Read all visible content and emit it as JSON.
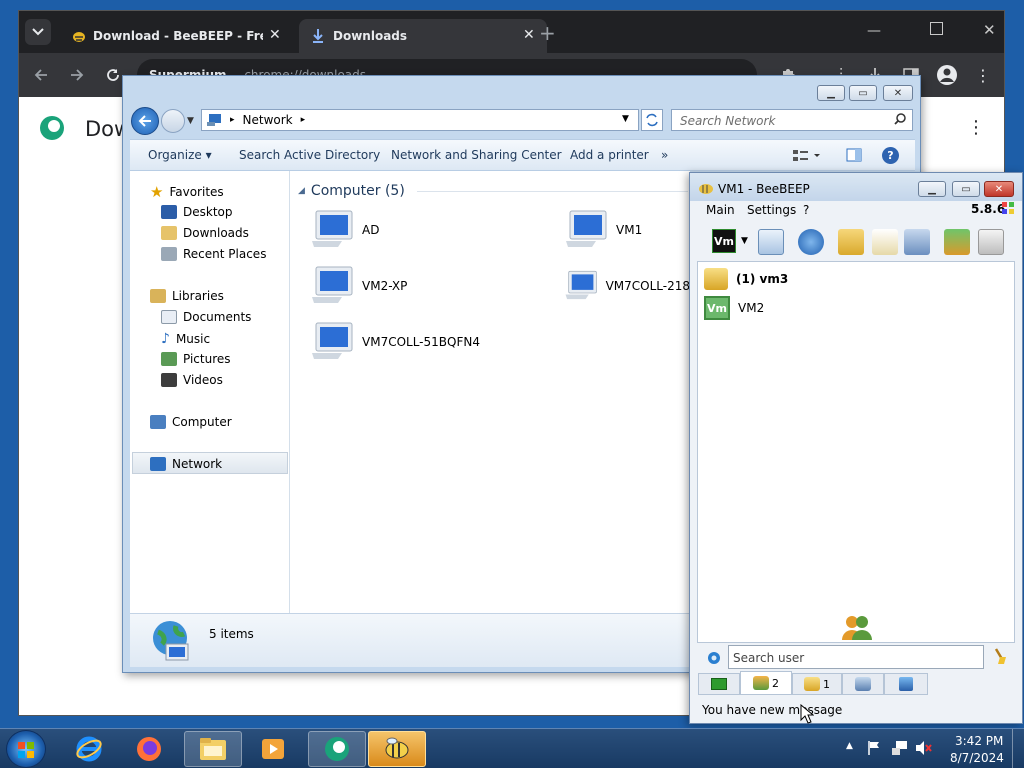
{
  "chrome": {
    "tabs": [
      {
        "label": "Download - BeeBEEP - Free Of",
        "active": false
      },
      {
        "label": "Downloads",
        "active": true
      }
    ],
    "address_scheme": "Supermium",
    "address_url": "chrome://downloads",
    "page_heading": "Dow"
  },
  "explorer": {
    "breadcrumb": "Network",
    "search_placeholder": "Search Network",
    "commands": [
      "Organize",
      "Search Active Directory",
      "Network and Sharing Center",
      "Add a printer",
      "»"
    ],
    "nav": {
      "favorites_label": "Favorites",
      "favorites": [
        "Desktop",
        "Downloads",
        "Recent Places"
      ],
      "libraries_label": "Libraries",
      "libraries": [
        "Documents",
        "Music",
        "Pictures",
        "Videos"
      ],
      "computer_label": "Computer",
      "network_label": "Network"
    },
    "group_header": "Computer (5)",
    "computers": [
      "AD",
      "VM1",
      "VM2-XP",
      "VM7COLL-218",
      "VM7COLL-51BQFN4"
    ],
    "status_count": "5 items"
  },
  "beebeep": {
    "title": "VM1 - BeeBEEP",
    "menu": [
      "Main",
      "Settings",
      "?"
    ],
    "version": "5.8.6",
    "avatar_label": "Vm",
    "users": [
      {
        "label": "(1) vm3",
        "bold": true
      },
      {
        "label": "VM2",
        "bold": false
      }
    ],
    "search_placeholder": "Search user",
    "tabs": [
      {
        "count": ""
      },
      {
        "count": "2"
      },
      {
        "count": "1"
      },
      {
        "count": ""
      },
      {
        "count": ""
      }
    ],
    "status": "You have new message"
  },
  "taskbar": {
    "time": "3:42 PM",
    "date": "8/7/2024"
  },
  "colors": {
    "chrome_dark": "#202124",
    "explorer_frame": "#c5d9ee",
    "accent_blue": "#1e395b",
    "taskbar": "#1f4a7a"
  }
}
